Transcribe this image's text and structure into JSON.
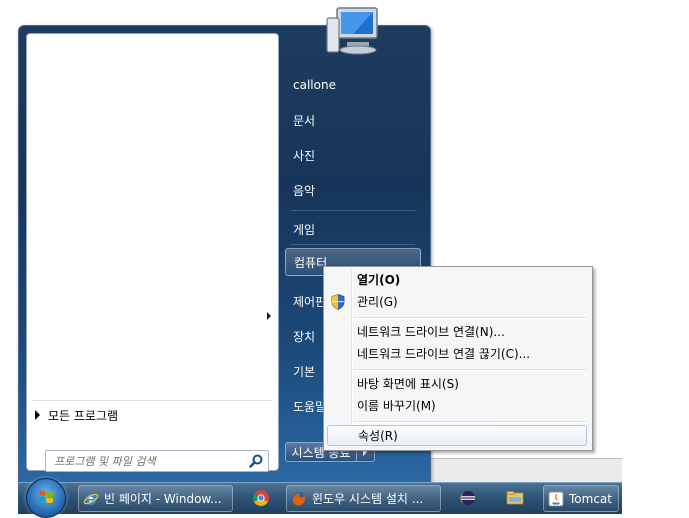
{
  "start_menu": {
    "all_programs_label": "모든 프로그램",
    "search_placeholder": "프로그램 및 파일 검색",
    "right_items": [
      {
        "label": "callone"
      },
      {
        "label": "문서"
      },
      {
        "label": "사진"
      },
      {
        "label": "음악"
      },
      {
        "label": "게임"
      },
      {
        "label": "컴퓨터"
      },
      {
        "label": "제어판"
      },
      {
        "label": "장치"
      },
      {
        "label": "기본"
      },
      {
        "label": "도움말"
      }
    ],
    "shutdown_label": "시스템 종료"
  },
  "context_menu": {
    "items": [
      {
        "label": "열기(O)"
      },
      {
        "label": "관리(G)"
      },
      {
        "label": "네트워크 드라이브 연결(N)..."
      },
      {
        "label": "네트워크 드라이브 연결 끊기(C)..."
      },
      {
        "label": "바탕 화면에 표시(S)"
      },
      {
        "label": "이름 바꾸기(M)"
      },
      {
        "label": "속성(R)"
      }
    ]
  },
  "taskbar": {
    "buttons": [
      {
        "label": "빈 페이지 - Window...",
        "icon": "internet-explorer-icon"
      },
      {
        "label": "윈도우 시스템 설치 ...",
        "icon": "firefox-icon"
      },
      {
        "label": "Tomcat",
        "icon": "java-icon"
      }
    ],
    "pinned_icons": [
      "chrome-icon",
      "eclipse-icon",
      "explorer-folder-icon"
    ]
  },
  "colors": {
    "menu_blue": "#17355a",
    "highlight_border": "#a8c6ee",
    "taskbar": "#2e5478"
  }
}
